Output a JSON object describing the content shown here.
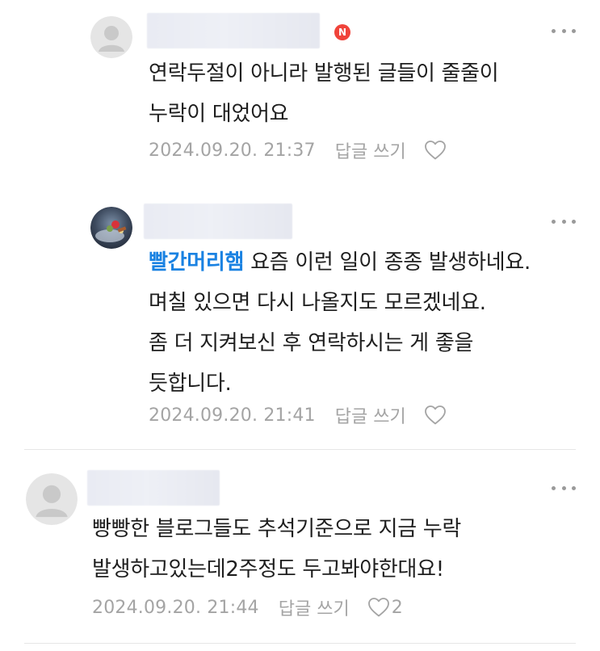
{
  "comments": [
    {
      "author_badge": "N",
      "lines": [
        "연락두절이 아니라 발행된 글들이 줄줄이",
        "누락이 대었어요"
      ],
      "date": "2024.09.20. 21:37",
      "reply_label": "답글 쓰기"
    },
    {
      "mention": "빨간머리햄",
      "first_line_rest": " 요즘 이런 일이 종종 발생하네요.",
      "lines": [
        "며칠 있으면 다시 나올지도 모르겠네요.",
        "좀 더 지켜보신 후 연락하시는 게 좋을",
        "듯합니다."
      ],
      "date": "2024.09.20. 21:41",
      "reply_label": "답글 쓰기"
    },
    {
      "lines": [
        "빵빵한 블로그들도 추석기준으로 지금 누락",
        "발생하고있는데2주정도 두고봐야한대요!"
      ],
      "date": "2024.09.20. 21:44",
      "reply_label": "답글 쓰기",
      "like_count": "2"
    }
  ],
  "colors": {
    "mention": "#1a82e2",
    "badge": "#f0433a",
    "meta": "#a4a4a4",
    "divider": "#e6e6e6"
  },
  "icons": {
    "more": "more-horizontal-icon",
    "like": "heart-outline-icon",
    "default_avatar": "default-avatar-icon",
    "badge": "naver-badge-icon"
  }
}
